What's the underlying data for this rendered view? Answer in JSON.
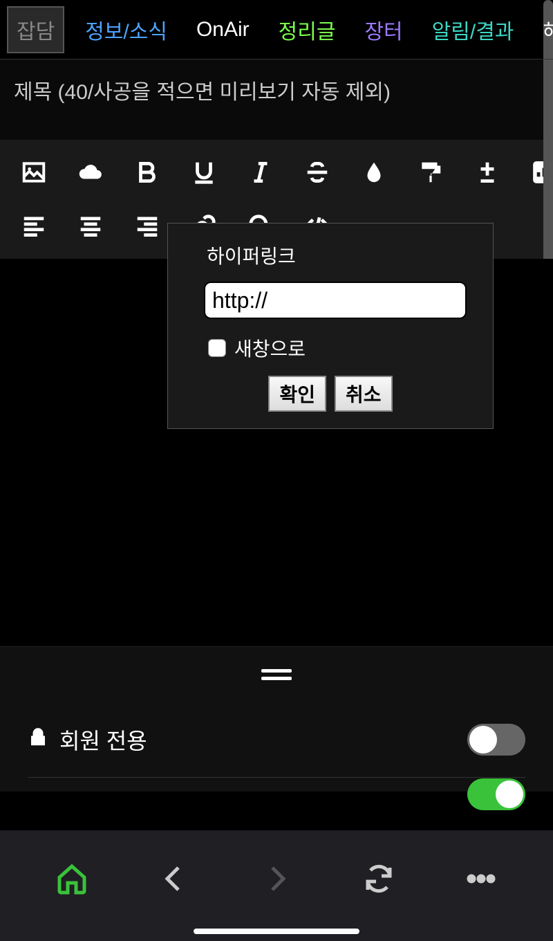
{
  "tabs": [
    {
      "label": "잡담",
      "cls": "selected"
    },
    {
      "label": "정보/소식",
      "cls": "blue"
    },
    {
      "label": "OnAir",
      "cls": "white"
    },
    {
      "label": "정리글",
      "cls": "green"
    },
    {
      "label": "장터",
      "cls": "purple"
    },
    {
      "label": "알림/결과",
      "cls": "teal"
    },
    {
      "label": "해제",
      "cls": "white"
    }
  ],
  "title_placeholder": "제목 (40/사공을 적으면 미리보기 자동 제외)",
  "hyperlink": {
    "title": "하이퍼링크",
    "url_value": "http://",
    "new_window_label": "새창으로",
    "confirm": "확인",
    "cancel": "취소"
  },
  "options": {
    "members_only": "회원 전용"
  },
  "toolbar_icons": {
    "row1": [
      "image",
      "cloud",
      "bold",
      "underline",
      "italic",
      "strike",
      "tint",
      "paint",
      "plusminus",
      "chart"
    ],
    "row2": [
      "align-left",
      "align-center",
      "align-right",
      "link",
      "search",
      "code",
      "more"
    ]
  }
}
